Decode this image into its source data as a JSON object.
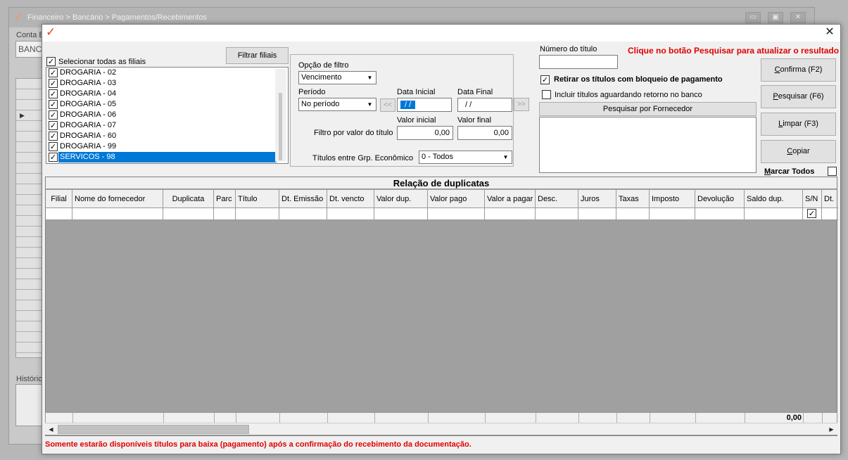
{
  "background_window": {
    "title": "Financeiro > Bancário > Pagamentos/Recebimentos",
    "conta_label": "Conta B",
    "conta_value": "BANC",
    "historico_label": "Histórico"
  },
  "dialog": {
    "logo_glyph": "✓",
    "close_glyph": "✕",
    "top_note": "Clique no botão Pesquisar para atualizar o resultado",
    "bottom_note": "Somente estarão disponíveis títulos para baixa (pagamento) após a confirmação do recebimento da documentação."
  },
  "branches": {
    "select_all_label": "Selecionar todas as filiais",
    "select_all_checked": true,
    "filter_button": "Filtrar filiais",
    "items": [
      {
        "label": "DROGARIA - 02",
        "checked": true
      },
      {
        "label": "DROGARIA - 03",
        "checked": true
      },
      {
        "label": "DROGARIA - 04",
        "checked": true
      },
      {
        "label": "DROGARIA - 05",
        "checked": true
      },
      {
        "label": "DROGARIA - 06",
        "checked": true
      },
      {
        "label": "DROGARIA - 07",
        "checked": true
      },
      {
        "label": "DROGARIA - 60",
        "checked": true
      },
      {
        "label": "DROGARIA - 99",
        "checked": true
      },
      {
        "label": "SERVICOS - 98",
        "checked": true,
        "selected": true
      }
    ]
  },
  "filter": {
    "option_label": "Opção de filtro",
    "option_value": "Vencimento",
    "period_label": "Período",
    "period_value": "No período",
    "date_start_label": "Data Inicial",
    "date_start_value": " /  /",
    "date_end_label": "Data Final",
    "date_end_value": " /  /",
    "prev_glyph": "<<",
    "next_glyph": ">>",
    "value_filter_label": "Filtro por valor do título",
    "value_start_label": "Valor inicial",
    "value_start": "0,00",
    "value_end_label": "Valor final",
    "value_end": "0,00",
    "group_label": "Títulos entre Grp. Econômico",
    "group_value": "0 - Todos"
  },
  "title_search": {
    "number_label": "Número do título",
    "number_value": "",
    "remove_blocked_label": "Retirar os títulos com bloqueio de pagamento",
    "remove_blocked_checked": true,
    "include_waiting_label": "Incluir títulos aguardando retorno no banco",
    "include_waiting_checked": false,
    "supplier_button": "Pesquisar por Fornecedor"
  },
  "actions": {
    "confirm": "Confirma (F2)",
    "confirm_u": "C",
    "confirm_rest": "onfirma (F2)",
    "search_u": "P",
    "search_rest": "esquisar (F6)",
    "clear_u": "L",
    "clear_rest": "impar (F3)",
    "copy_u": "C",
    "copy_rest": "opiar",
    "mark_all_u": "M",
    "mark_all_rest": "arcar Todos",
    "mark_all_checked": false
  },
  "grid": {
    "caption": "Relação de duplicatas",
    "columns": [
      "Filial",
      "Nome do fornecedor",
      "Duplicata",
      "Parc",
      "Título",
      "Dt. Emissão",
      "Dt. vencto",
      "Valor dup.",
      "Valor pago",
      "Valor a pagar",
      "Desc.",
      "Juros",
      "Taxas",
      "Imposto",
      "Devolução",
      "Saldo dup.",
      "S/N",
      "Dt."
    ],
    "row_sn_checked": true,
    "footer_total": "0,00"
  },
  "icons": {
    "check": "✓",
    "dropdown": "▼",
    "scroll_left": "◀",
    "scroll_right": "▶"
  }
}
